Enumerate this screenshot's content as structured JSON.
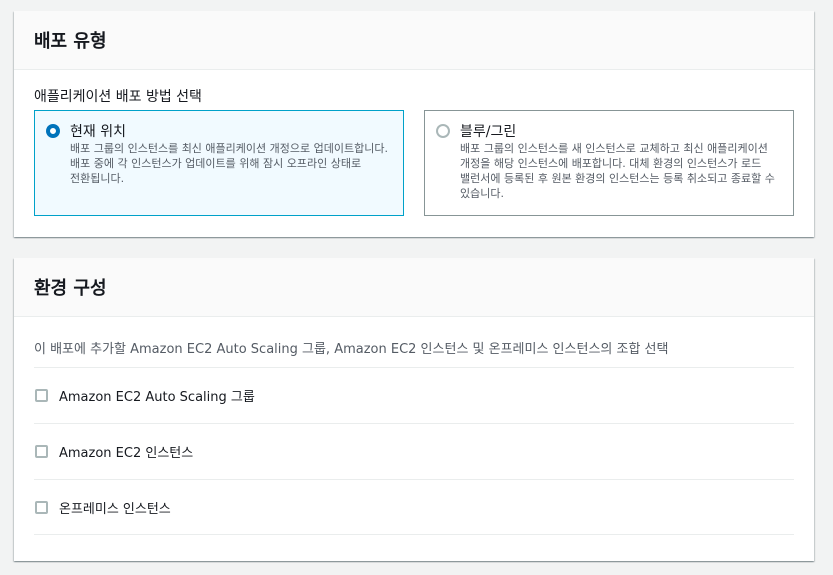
{
  "deployment_type": {
    "title": "배포 유형",
    "field_label": "애플리케이션 배포 방법 선택",
    "options": [
      {
        "title": "현재 위치",
        "description": "배포 그룹의 인스턴스를 최신 애플리케이션 개정으로 업데이트합니다. 배포 중에 각 인스턴스가 업데이트를 위해 잠시 오프라인 상태로 전환됩니다.",
        "selected": true
      },
      {
        "title": "블루/그린",
        "description": "배포 그룹의 인스턴스를 새 인스턴스로 교체하고 최신 애플리케이션 개정을 해당 인스턴스에 배포합니다. 대체 환경의 인스턴스가 로드 밸런서에 등록된 후 원본 환경의 인스턴스는 등록 취소되고 종료할 수 있습니다.",
        "selected": false
      }
    ]
  },
  "environment": {
    "title": "환경 구성",
    "description": "이 배포에 추가할 Amazon EC2 Auto Scaling 그룹, Amazon EC2 인스턴스 및 온프레미스 인스턴스의 조합 선택",
    "options": [
      {
        "label": "Amazon EC2 Auto Scaling 그룹",
        "checked": false
      },
      {
        "label": "Amazon EC2 인스턴스",
        "checked": false
      },
      {
        "label": "온프레미스 인스턴스",
        "checked": false
      }
    ]
  },
  "colors": {
    "accent": "#0073bb",
    "selected_border": "#00a1c9",
    "selected_bg": "#f1faff"
  }
}
